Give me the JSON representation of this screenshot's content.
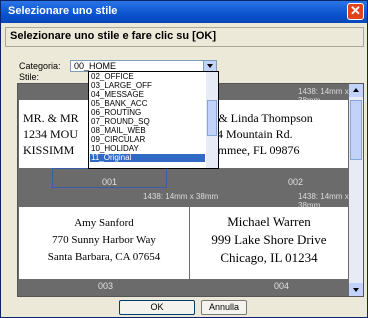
{
  "window": {
    "title": "Selezionare uno stile"
  },
  "header": {
    "text": "Selezionare uno stile e fare clic su [OK]"
  },
  "labels": {
    "category": "Categoria:",
    "style": "Stile:"
  },
  "category": {
    "selected": "00_HOME",
    "options": [
      "02_OFFICE",
      "03_LARGE_OFF",
      "04_MESSAGE",
      "05_BANK_ACC",
      "06_ROUTING",
      "07_ROUND_SQ",
      "08_MAIL_WEB",
      "09_CIRCULAR",
      "10_HOLIDAY",
      "11_Original"
    ],
    "highlighted": "11_Original"
  },
  "styles": [
    {
      "number": "001",
      "size": "",
      "lines": [
        "MR. & MR",
        "1234 MOU",
        "KISSIMM"
      ]
    },
    {
      "number": "002",
      "size": "1438: 14mm x 38mm",
      "lines": [
        "ve & Linda Thompson",
        "234 Mountain Rd.",
        "ssimmee, FL 09876"
      ]
    },
    {
      "number": "003",
      "size": "1438: 14mm x 38mm",
      "lines": [
        "Amy Sanford",
        "770 Sunny Harbor Way",
        "Santa Barbara, CA 07654"
      ]
    },
    {
      "number": "004",
      "size": "1438: 14mm x 38mm",
      "lines": [
        "Michael Warren",
        "999 Lake Shore Drive",
        "Chicago, IL 01234"
      ]
    }
  ],
  "top_size": {
    "left": "1438: 14mm x 38mm"
  },
  "buttons": {
    "ok": "OK",
    "cancel": "Annulla"
  },
  "icons": {
    "close": "close-icon",
    "dropdown": "chevron-down-icon"
  }
}
